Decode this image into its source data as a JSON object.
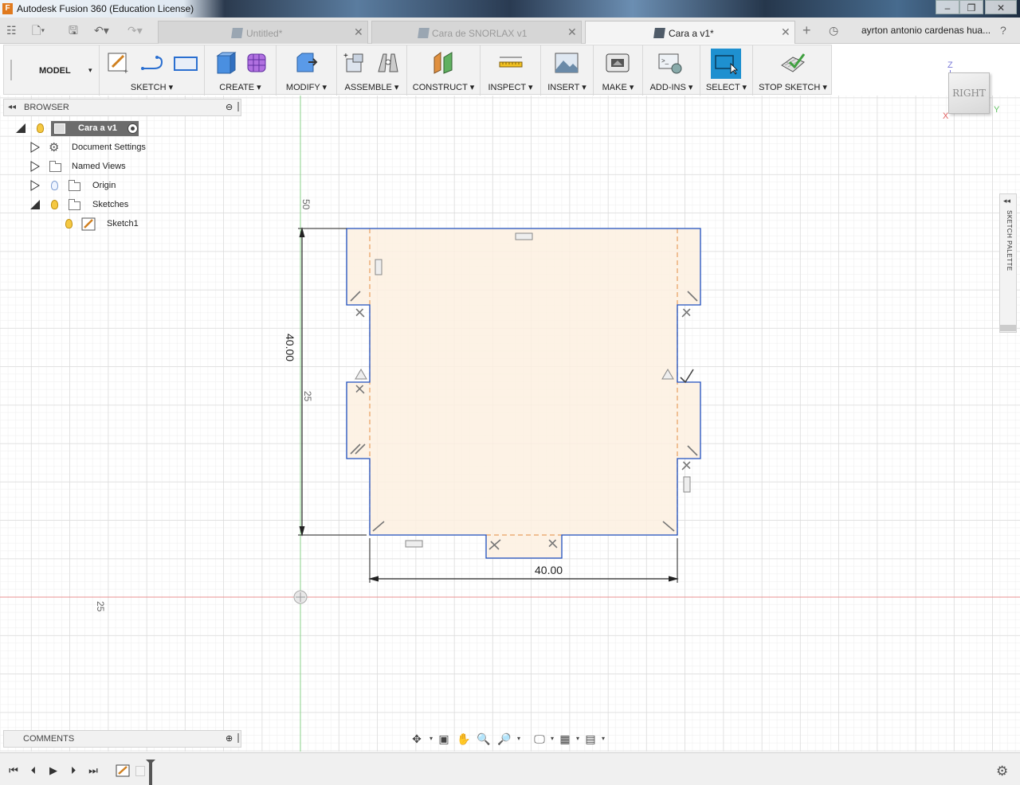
{
  "window": {
    "title": "Autodesk Fusion 360 (Education License)",
    "minimize_icon": "minimize-icon",
    "restore_icon": "restore-icon",
    "close_icon": "close-icon"
  },
  "tabs": [
    {
      "label": "Untitled*",
      "active": false
    },
    {
      "label": "Cara de SNORLAX v1",
      "active": false
    },
    {
      "label": "Cara a v1*",
      "active": true
    }
  ],
  "user": {
    "name": "ayrton antonio cardenas hua..."
  },
  "toolbar": {
    "workspace": "MODEL",
    "groups": [
      {
        "label": "SKETCH"
      },
      {
        "label": "CREATE"
      },
      {
        "label": "MODIFY"
      },
      {
        "label": "ASSEMBLE"
      },
      {
        "label": "CONSTRUCT"
      },
      {
        "label": "INSPECT"
      },
      {
        "label": "INSERT"
      },
      {
        "label": "MAKE"
      },
      {
        "label": "ADD-INS"
      },
      {
        "label": "SELECT"
      },
      {
        "label": "STOP SKETCH"
      }
    ]
  },
  "viewcube": {
    "face": "RIGHT",
    "axis_z": "Z",
    "axis_x": "X",
    "axis_y": "Y"
  },
  "browser": {
    "title": "BROWSER",
    "items": [
      {
        "label": "Cara a v1"
      },
      {
        "label": "Document Settings"
      },
      {
        "label": "Named Views"
      },
      {
        "label": "Origin"
      },
      {
        "label": "Sketches"
      },
      {
        "label": "Sketch1"
      }
    ]
  },
  "comments": {
    "title": "COMMENTS"
  },
  "sketch_palette": {
    "title": "SKETCH PALETTE"
  },
  "canvas": {
    "dim_height": "40.00",
    "dim_width": "40.00",
    "ruler_50": "50",
    "ruler_25_v": "25",
    "ruler_25_h": "25"
  },
  "colors": {
    "sketch_fill": "#fdf0e0",
    "sketch_outline": "#1f4fbf",
    "construction": "#e8a060",
    "x_axis": "#e06060",
    "y_axis": "#60c060",
    "select_active": "#1e90d0"
  }
}
